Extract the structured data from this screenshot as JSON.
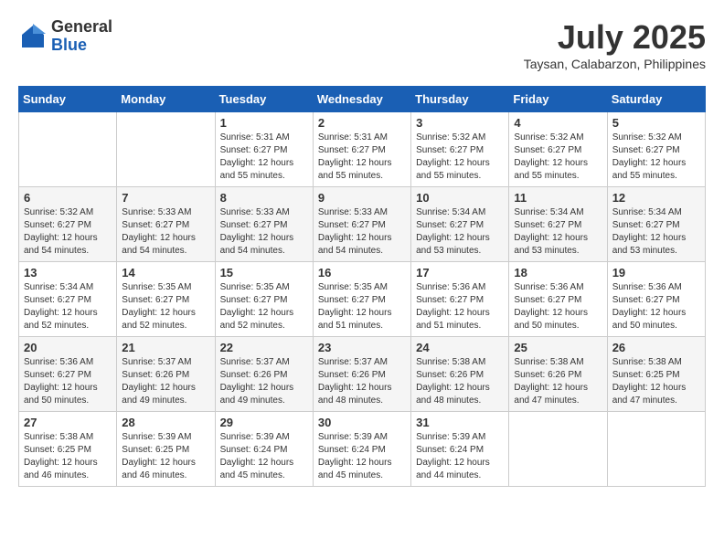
{
  "header": {
    "logo_general": "General",
    "logo_blue": "Blue",
    "month_year": "July 2025",
    "location": "Taysan, Calabarzon, Philippines"
  },
  "weekdays": [
    "Sunday",
    "Monday",
    "Tuesday",
    "Wednesday",
    "Thursday",
    "Friday",
    "Saturday"
  ],
  "weeks": [
    [
      {
        "day": "",
        "detail": ""
      },
      {
        "day": "",
        "detail": ""
      },
      {
        "day": "1",
        "detail": "Sunrise: 5:31 AM\nSunset: 6:27 PM\nDaylight: 12 hours\nand 55 minutes."
      },
      {
        "day": "2",
        "detail": "Sunrise: 5:31 AM\nSunset: 6:27 PM\nDaylight: 12 hours\nand 55 minutes."
      },
      {
        "day": "3",
        "detail": "Sunrise: 5:32 AM\nSunset: 6:27 PM\nDaylight: 12 hours\nand 55 minutes."
      },
      {
        "day": "4",
        "detail": "Sunrise: 5:32 AM\nSunset: 6:27 PM\nDaylight: 12 hours\nand 55 minutes."
      },
      {
        "day": "5",
        "detail": "Sunrise: 5:32 AM\nSunset: 6:27 PM\nDaylight: 12 hours\nand 55 minutes."
      }
    ],
    [
      {
        "day": "6",
        "detail": "Sunrise: 5:32 AM\nSunset: 6:27 PM\nDaylight: 12 hours\nand 54 minutes."
      },
      {
        "day": "7",
        "detail": "Sunrise: 5:33 AM\nSunset: 6:27 PM\nDaylight: 12 hours\nand 54 minutes."
      },
      {
        "day": "8",
        "detail": "Sunrise: 5:33 AM\nSunset: 6:27 PM\nDaylight: 12 hours\nand 54 minutes."
      },
      {
        "day": "9",
        "detail": "Sunrise: 5:33 AM\nSunset: 6:27 PM\nDaylight: 12 hours\nand 54 minutes."
      },
      {
        "day": "10",
        "detail": "Sunrise: 5:34 AM\nSunset: 6:27 PM\nDaylight: 12 hours\nand 53 minutes."
      },
      {
        "day": "11",
        "detail": "Sunrise: 5:34 AM\nSunset: 6:27 PM\nDaylight: 12 hours\nand 53 minutes."
      },
      {
        "day": "12",
        "detail": "Sunrise: 5:34 AM\nSunset: 6:27 PM\nDaylight: 12 hours\nand 53 minutes."
      }
    ],
    [
      {
        "day": "13",
        "detail": "Sunrise: 5:34 AM\nSunset: 6:27 PM\nDaylight: 12 hours\nand 52 minutes."
      },
      {
        "day": "14",
        "detail": "Sunrise: 5:35 AM\nSunset: 6:27 PM\nDaylight: 12 hours\nand 52 minutes."
      },
      {
        "day": "15",
        "detail": "Sunrise: 5:35 AM\nSunset: 6:27 PM\nDaylight: 12 hours\nand 52 minutes."
      },
      {
        "day": "16",
        "detail": "Sunrise: 5:35 AM\nSunset: 6:27 PM\nDaylight: 12 hours\nand 51 minutes."
      },
      {
        "day": "17",
        "detail": "Sunrise: 5:36 AM\nSunset: 6:27 PM\nDaylight: 12 hours\nand 51 minutes."
      },
      {
        "day": "18",
        "detail": "Sunrise: 5:36 AM\nSunset: 6:27 PM\nDaylight: 12 hours\nand 50 minutes."
      },
      {
        "day": "19",
        "detail": "Sunrise: 5:36 AM\nSunset: 6:27 PM\nDaylight: 12 hours\nand 50 minutes."
      }
    ],
    [
      {
        "day": "20",
        "detail": "Sunrise: 5:36 AM\nSunset: 6:27 PM\nDaylight: 12 hours\nand 50 minutes."
      },
      {
        "day": "21",
        "detail": "Sunrise: 5:37 AM\nSunset: 6:26 PM\nDaylight: 12 hours\nand 49 minutes."
      },
      {
        "day": "22",
        "detail": "Sunrise: 5:37 AM\nSunset: 6:26 PM\nDaylight: 12 hours\nand 49 minutes."
      },
      {
        "day": "23",
        "detail": "Sunrise: 5:37 AM\nSunset: 6:26 PM\nDaylight: 12 hours\nand 48 minutes."
      },
      {
        "day": "24",
        "detail": "Sunrise: 5:38 AM\nSunset: 6:26 PM\nDaylight: 12 hours\nand 48 minutes."
      },
      {
        "day": "25",
        "detail": "Sunrise: 5:38 AM\nSunset: 6:26 PM\nDaylight: 12 hours\nand 47 minutes."
      },
      {
        "day": "26",
        "detail": "Sunrise: 5:38 AM\nSunset: 6:25 PM\nDaylight: 12 hours\nand 47 minutes."
      }
    ],
    [
      {
        "day": "27",
        "detail": "Sunrise: 5:38 AM\nSunset: 6:25 PM\nDaylight: 12 hours\nand 46 minutes."
      },
      {
        "day": "28",
        "detail": "Sunrise: 5:39 AM\nSunset: 6:25 PM\nDaylight: 12 hours\nand 46 minutes."
      },
      {
        "day": "29",
        "detail": "Sunrise: 5:39 AM\nSunset: 6:24 PM\nDaylight: 12 hours\nand 45 minutes."
      },
      {
        "day": "30",
        "detail": "Sunrise: 5:39 AM\nSunset: 6:24 PM\nDaylight: 12 hours\nand 45 minutes."
      },
      {
        "day": "31",
        "detail": "Sunrise: 5:39 AM\nSunset: 6:24 PM\nDaylight: 12 hours\nand 44 minutes."
      },
      {
        "day": "",
        "detail": ""
      },
      {
        "day": "",
        "detail": ""
      }
    ]
  ]
}
